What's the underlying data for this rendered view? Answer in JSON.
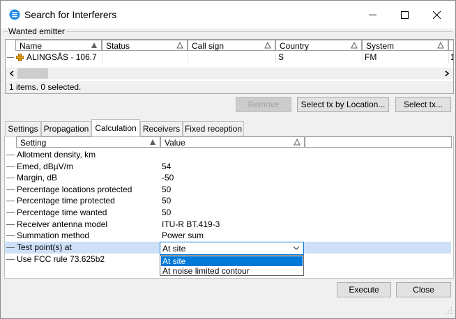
{
  "window": {
    "title": "Search for Interferers"
  },
  "wanted_emitter": {
    "group_label": "Wanted emitter",
    "columns": [
      "Name",
      "Status",
      "Call sign",
      "Country",
      "System"
    ],
    "rows": [
      {
        "name": "ALINGSÅS - 106.7",
        "status": "",
        "call_sign": "",
        "country": "S",
        "system": "FM",
        "extra": "1"
      }
    ],
    "status_text": "1 items. 0 selected."
  },
  "buttons": {
    "remove": "Remove",
    "select_by_location": "Select tx by Location...",
    "select_tx": "Select tx...",
    "execute": "Execute",
    "close": "Close"
  },
  "tabs": [
    "Settings",
    "Propagation",
    "Calculation",
    "Receivers",
    "Fixed reception"
  ],
  "active_tab": "Calculation",
  "calc_grid": {
    "columns": [
      "Setting",
      "Value"
    ],
    "rows": [
      {
        "setting": "Allotment density, km",
        "value": ""
      },
      {
        "setting": "Emed, dBµV/m",
        "value": "54"
      },
      {
        "setting": "Margin, dB",
        "value": "-50"
      },
      {
        "setting": "Percentage locations protected",
        "value": "50"
      },
      {
        "setting": "Percentage time protected",
        "value": "50"
      },
      {
        "setting": "Percentage time wanted",
        "value": "50"
      },
      {
        "setting": "Receiver antenna model",
        "value": "ITU-R BT.419-3"
      },
      {
        "setting": "Summation method",
        "value": "Power sum"
      },
      {
        "setting": "Test point(s) at",
        "value": "At site"
      },
      {
        "setting": "Use FCC rule 73.625b2",
        "value": ""
      }
    ],
    "dropdown_options": [
      "At site",
      "At noise limited contour"
    ],
    "dropdown_highlighted": "At site"
  },
  "colors": {
    "selection": "#cde0f7",
    "accent": "#0078d7",
    "cross_icon": "#e8a317"
  }
}
